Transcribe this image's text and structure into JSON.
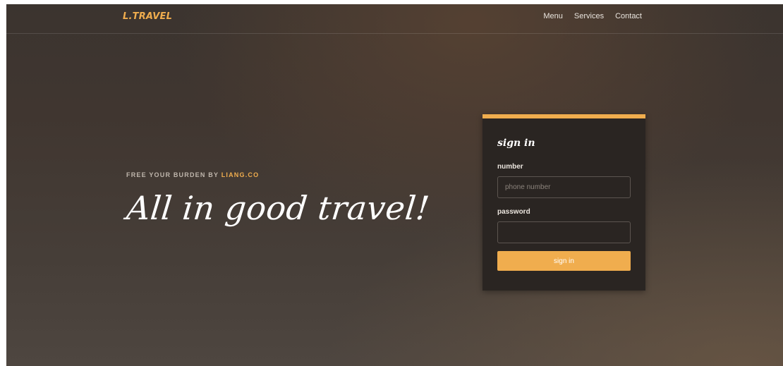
{
  "navbar": {
    "brand": "L.TRAVEL",
    "links": [
      "Menu",
      "Services",
      "Contact"
    ]
  },
  "hero": {
    "subtitle_prefix": "FREE YOUR BURDEN BY",
    "subtitle_accent": "LIANG.CO",
    "title": "All in good travel!"
  },
  "login": {
    "title": "sign in",
    "number_label": "number",
    "number_placeholder": "phone number",
    "number_value": "",
    "password_label": "password",
    "password_value": "",
    "submit_label": "sign in"
  },
  "colors": {
    "accent": "#f0ad4e",
    "card_background": "#2a2522"
  }
}
